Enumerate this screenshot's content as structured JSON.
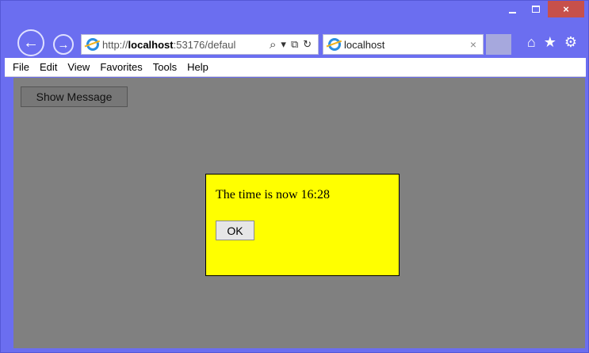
{
  "browser": {
    "address_prefix": "http://",
    "address_host": "localhost",
    "address_rest": ":53176/defaul",
    "tab_title": "localhost",
    "tab_close": "×",
    "caption": {
      "minimize": "",
      "maximize": "",
      "close": "×"
    },
    "icons": {
      "back": "←",
      "forward": "→",
      "search": "⌕",
      "dropdown": "▾",
      "compat": "⧉",
      "refresh": "↻",
      "home": "⌂",
      "favorites": "★",
      "tools": "⚙"
    }
  },
  "menu": [
    {
      "label": "File"
    },
    {
      "label": "Edit"
    },
    {
      "label": "View"
    },
    {
      "label": "Favorites"
    },
    {
      "label": "Tools"
    },
    {
      "label": "Help"
    }
  ],
  "page": {
    "show_button": "Show Message",
    "dialog": {
      "message": "The time is now 16:28",
      "ok_button": "OK"
    }
  },
  "colors": {
    "chrome": "#6b6ef0",
    "content_bg": "#808080",
    "dialog_bg": "#ffff00",
    "close_btn": "#c7504b"
  }
}
